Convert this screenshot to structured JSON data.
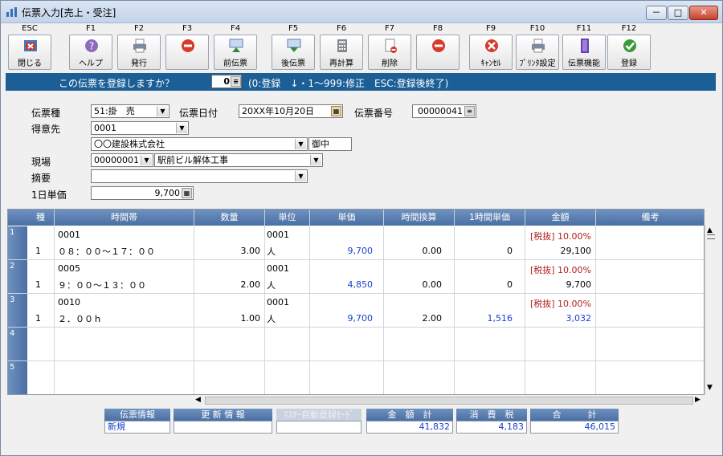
{
  "window": {
    "title": "伝票入力[売上・受注]",
    "controls": {
      "min": "－",
      "max": "□",
      "close": "✕"
    }
  },
  "toolbar": [
    {
      "key": "ESC",
      "label": "閉じる",
      "icon": "close-window-icon",
      "color": "#c83a2a"
    },
    {
      "key": "F1",
      "label": "ヘルプ",
      "icon": "help-icon",
      "color": "#8a6bc0"
    },
    {
      "key": "F2",
      "label": "発行",
      "icon": "printer-icon",
      "color": "#7a8aa0"
    },
    {
      "key": "F3",
      "label": "",
      "icon": "prohibited-icon",
      "color": "#d63a2a"
    },
    {
      "key": "F4",
      "label": "前伝票",
      "icon": "previous-slip-icon",
      "color": "#2f8a3a"
    },
    {
      "key": "F5",
      "label": "後伝票",
      "icon": "next-slip-icon",
      "color": "#2f8a3a"
    },
    {
      "key": "F6",
      "label": "再計算",
      "icon": "calculator-icon",
      "color": "#707070"
    },
    {
      "key": "F7",
      "label": "削除",
      "icon": "delete-icon",
      "color": "#c83a2a"
    },
    {
      "key": "F8",
      "label": "",
      "icon": "prohibited-icon",
      "color": "#d63a2a"
    },
    {
      "key": "F9",
      "label": "ｷｬﾝｾﾙ",
      "icon": "cancel-icon",
      "color": "#d63a2a"
    },
    {
      "key": "F10",
      "label": "ﾌﾟﾘﾝﾀ設定",
      "icon": "printer-settings-icon",
      "color": "#7a8aa0"
    },
    {
      "key": "F11",
      "label": "伝票機能",
      "icon": "slip-function-icon",
      "color": "#6a3fb5"
    },
    {
      "key": "F12",
      "label": "登録",
      "icon": "register-check-icon",
      "color": "#3a9a3a"
    }
  ],
  "prompt": {
    "question": "この伝票を登録しますか？",
    "value": "0",
    "hint": "(0:登録　↓・1～999:修正　ESC:登録後終了)"
  },
  "form": {
    "slip_type_label": "伝票種",
    "slip_type_value": "51:掛　売",
    "slip_date_label": "伝票日付",
    "slip_date_value": "20XX年10月20日",
    "slip_number_label": "伝票番号",
    "slip_number_value": "00000041",
    "customer_label": "得意先",
    "customer_code": "0001",
    "customer_name": "〇〇建設株式会社",
    "honorific": "御中",
    "site_label": "現場",
    "site_code": "00000001",
    "site_name": "駅前ビル解体工事",
    "summary_label": "摘要",
    "summary_value": "",
    "daily_rate_label": "1日単価",
    "daily_rate_value": "9,700"
  },
  "grid": {
    "headers": [
      "種",
      "時間帯",
      "数量",
      "単位",
      "単価",
      "時間換算",
      "1時間単価",
      "金額",
      "備考"
    ],
    "rows": [
      {
        "no": "1",
        "kind": "1",
        "code": "0001",
        "time": "０８：００～１７：００",
        "qty": "3.00",
        "unit_code": "0001",
        "unit": "人",
        "price": "9,700",
        "hours": "0.00",
        "hourly": "0",
        "tax": "[税抜] 10.00%",
        "amount": "29,100",
        "note": ""
      },
      {
        "no": "2",
        "kind": "1",
        "code": "0005",
        "time": "９：００～１３：００",
        "qty": "2.00",
        "unit_code": "0001",
        "unit": "人",
        "price": "4,850",
        "hours": "0.00",
        "hourly": "0",
        "tax": "[税抜] 10.00%",
        "amount": "9,700",
        "note": ""
      },
      {
        "no": "3",
        "kind": "1",
        "code": "0010",
        "time": "２．００ｈ",
        "qty": "1.00",
        "unit_code": "0001",
        "unit": "人",
        "price": "9,700",
        "hours": "2.00",
        "hourly": "1,516",
        "tax": "[税抜] 10.00%",
        "amount": "3,032",
        "note": ""
      },
      {
        "no": "4"
      },
      {
        "no": "5"
      }
    ]
  },
  "summary": {
    "slip_info_label": "伝票情報",
    "slip_info_value": "新規",
    "update_info_label": "更 新 情 報",
    "update_info_value": "",
    "master_mode_label": "ﾏｽﾀｰ自動登録ﾓｰﾄﾞ",
    "master_mode_value": "",
    "amount_total_label": "金　額　計",
    "amount_total_value": "41,832",
    "tax_label": "消　費　税",
    "tax_value": "4,183",
    "grand_total_label": "合　　　計",
    "grand_total_value": "46,015"
  }
}
